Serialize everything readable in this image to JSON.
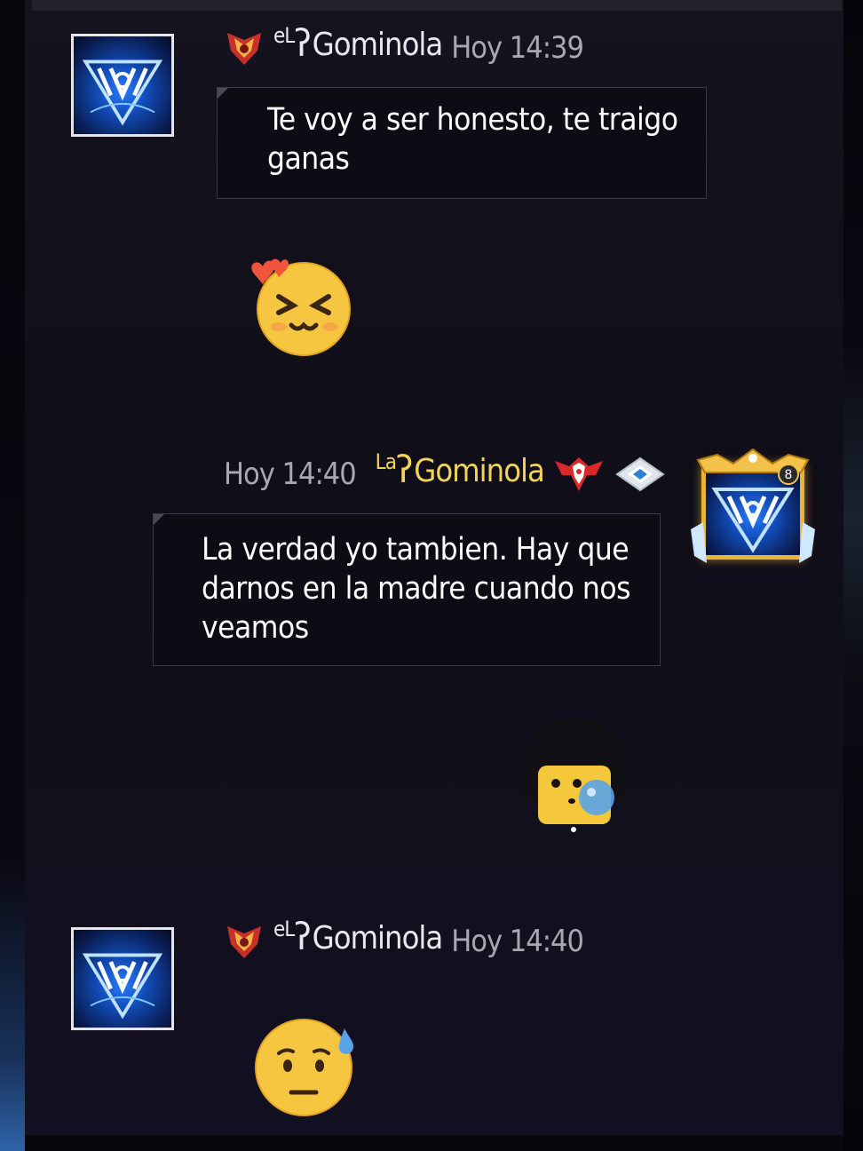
{
  "messages": [
    {
      "sender_prefix": "eL",
      "sender": "Gominola",
      "time": "Hoy 14:39",
      "text": "Te voy a ser honesto, te traigo ganas",
      "side": "left"
    },
    {
      "sender_prefix": "La",
      "sender": "Gominola",
      "time": "Hoy 14:40",
      "text": "La verdad yo tambien. Hay que darnos en la madre cuando nos veamos",
      "side": "right"
    },
    {
      "sender_prefix": "eL",
      "sender": "Gominola",
      "time": "Hoy 14:40",
      "text": "",
      "side": "left"
    }
  ],
  "stickers": [
    "excited-blush-emoji-sticker",
    "bubble-blowing-character-sticker",
    "worried-sweat-emoji-sticker"
  ],
  "avatar_level": "8",
  "colors": {
    "background": "#0b0a14",
    "bubble_bg": "#0d0c15",
    "bubble_border": "#3b3a45",
    "name_other": "#e9e9ee",
    "name_self": "#f3d35a",
    "time": "#a8a8b2",
    "avatar_frame_gold": "#e8b53a"
  }
}
